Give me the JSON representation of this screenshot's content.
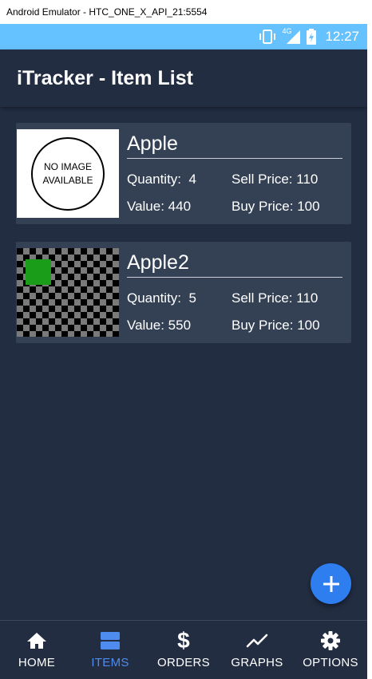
{
  "window": {
    "title": "Android Emulator - HTC_ONE_X_API_21:5554"
  },
  "status_bar": {
    "time": "12:27",
    "network_label": "4G",
    "color": "#66c2ff"
  },
  "app_bar": {
    "title": "iTracker - Item List"
  },
  "items": [
    {
      "name": "Apple",
      "image": "no-image",
      "image_text": [
        "NO IMAGE",
        "AVAILABLE"
      ],
      "quantity": "Quantity:  4",
      "sell_price": "Sell Price: 110",
      "value": "Value: 440",
      "buy_price": "Buy Price: 100"
    },
    {
      "name": "Apple2",
      "image": "checkerboard-with-green-square",
      "quantity": "Quantity:  5",
      "sell_price": "Sell Price: 110",
      "value": "Value: 550",
      "buy_price": "Buy Price: 100"
    }
  ],
  "fab": {
    "icon": "plus-icon",
    "color": "#2f7ef0"
  },
  "bottom_nav": {
    "items": [
      {
        "label": "HOME",
        "icon": "home-icon",
        "active": false
      },
      {
        "label": "ITEMS",
        "icon": "items-icon",
        "active": true
      },
      {
        "label": "ORDERS",
        "icon": "dollar-icon",
        "active": false
      },
      {
        "label": "GRAPHS",
        "icon": "graph-icon",
        "active": false
      },
      {
        "label": "OPTIONS",
        "icon": "gear-icon",
        "active": false
      }
    ],
    "active_color": "#4f8cf0"
  },
  "theme": {
    "background": "#222d42",
    "card": "#344154"
  }
}
